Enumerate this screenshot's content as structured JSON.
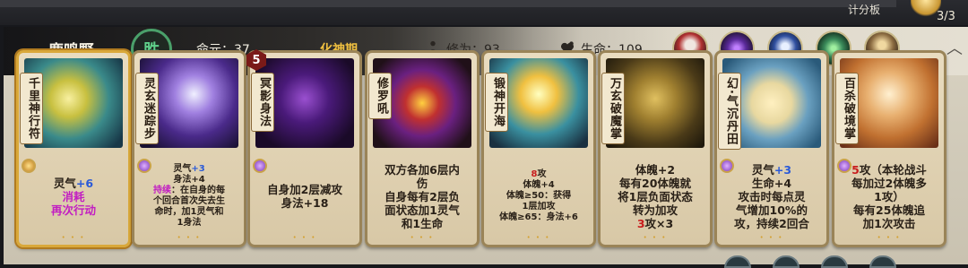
{
  "topbar": {
    "score_label": "计分板",
    "round": "3/3"
  },
  "player": {
    "name": "鹿鸣野",
    "result": "胜",
    "life_label": "命元：",
    "life": "37",
    "realm": "化神期",
    "cultivation_label": "修为：",
    "cultivation": "93",
    "hp_label": "生命：",
    "hp": "109"
  },
  "opponents": [
    "red-haired-cultivator",
    "purple-spirit",
    "blue-haired-cultivator",
    "green-spirit",
    "golden-warrior"
  ],
  "cards": [
    {
      "name": "千里神行符",
      "gem": "gold",
      "lines": [
        {
          "parts": [
            {
              "t": "灵气",
              "c": ""
            },
            {
              "t": "+6",
              "c": "blue"
            }
          ]
        },
        {
          "parts": [
            {
              "t": "消耗",
              "c": "magenta"
            }
          ]
        },
        {
          "parts": [
            {
              "t": "再次行动",
              "c": "magenta"
            }
          ]
        }
      ],
      "text_size": "big"
    },
    {
      "name": "灵玄迷踪步",
      "gem": "purple",
      "lines": [
        {
          "parts": [
            {
              "t": "灵气",
              "c": ""
            },
            {
              "t": "+3",
              "c": "blue"
            }
          ]
        },
        {
          "parts": [
            {
              "t": "身法+4",
              "c": ""
            }
          ]
        },
        {
          "parts": [
            {
              "t": "持续",
              "c": "magenta"
            },
            {
              "t": "：在自身的每",
              "c": ""
            }
          ]
        },
        {
          "parts": [
            {
              "t": "个回合首次失去生",
              "c": ""
            }
          ]
        },
        {
          "parts": [
            {
              "t": "命时，加1灵气和",
              "c": ""
            }
          ]
        },
        {
          "parts": [
            {
              "t": "1身法",
              "c": ""
            }
          ]
        }
      ],
      "text_size": "small"
    },
    {
      "name": "冥影身法",
      "gem": "purple",
      "cost": "5",
      "lines": [
        {
          "parts": [
            {
              "t": "自身加2层减攻",
              "c": ""
            }
          ]
        },
        {
          "parts": [
            {
              "t": "身法+18",
              "c": ""
            }
          ]
        }
      ],
      "text_size": "big"
    },
    {
      "name": "修罗吼",
      "gem": "",
      "lines": [
        {
          "parts": [
            {
              "t": "双方各加6层内",
              "c": ""
            }
          ]
        },
        {
          "parts": [
            {
              "t": "伤",
              "c": ""
            }
          ]
        },
        {
          "parts": [
            {
              "t": "自身每有2层负",
              "c": ""
            }
          ]
        },
        {
          "parts": [
            {
              "t": "面状态加1灵气",
              "c": ""
            }
          ]
        },
        {
          "parts": [
            {
              "t": "和1生命",
              "c": ""
            }
          ]
        }
      ],
      "text_size": "big"
    },
    {
      "name": "锻神开海",
      "gem": "",
      "lines": [
        {
          "parts": [
            {
              "t": "8",
              "c": "red"
            },
            {
              "t": "攻",
              "c": ""
            }
          ]
        },
        {
          "parts": [
            {
              "t": "体魄+4",
              "c": ""
            }
          ]
        },
        {
          "parts": [
            {
              "t": "体魄≥50：获得",
              "c": ""
            }
          ]
        },
        {
          "parts": [
            {
              "t": "1层加攻",
              "c": ""
            }
          ]
        },
        {
          "parts": [
            {
              "t": "体魄≥65：身法+6",
              "c": ""
            }
          ]
        }
      ],
      "text_size": "small"
    },
    {
      "name": "万玄破魔掌",
      "gem": "",
      "lines": [
        {
          "parts": [
            {
              "t": "体魄+2",
              "c": ""
            }
          ]
        },
        {
          "parts": [
            {
              "t": "每有20体魄就",
              "c": ""
            }
          ]
        },
        {
          "parts": [
            {
              "t": "将1层负面状态",
              "c": ""
            }
          ]
        },
        {
          "parts": [
            {
              "t": "转为加攻",
              "c": ""
            }
          ]
        },
        {
          "parts": [
            {
              "t": "3",
              "c": "red"
            },
            {
              "t": "攻×3",
              "c": ""
            }
          ]
        }
      ],
      "text_size": "big"
    },
    {
      "name": "幻·气沉丹田",
      "gem": "purple",
      "lines": [
        {
          "parts": [
            {
              "t": "灵气",
              "c": ""
            },
            {
              "t": "+3",
              "c": "blue"
            }
          ]
        },
        {
          "parts": [
            {
              "t": "生命+4",
              "c": ""
            }
          ]
        },
        {
          "parts": [
            {
              "t": "攻击时每点灵",
              "c": ""
            }
          ]
        },
        {
          "parts": [
            {
              "t": "气增加10%的",
              "c": ""
            }
          ]
        },
        {
          "parts": [
            {
              "t": "攻，持续2回合",
              "c": ""
            }
          ]
        }
      ],
      "text_size": "big"
    },
    {
      "name": "百杀破境掌",
      "gem": "purple",
      "lines": [
        {
          "parts": [
            {
              "t": "5",
              "c": "red"
            },
            {
              "t": "攻（本轮战斗",
              "c": ""
            }
          ]
        },
        {
          "parts": [
            {
              "t": "每加过2体魄多",
              "c": ""
            }
          ]
        },
        {
          "parts": [
            {
              "t": "1攻）",
              "c": ""
            }
          ]
        },
        {
          "parts": [
            {
              "t": "每有25体魄追",
              "c": ""
            }
          ]
        },
        {
          "parts": [
            {
              "t": "加1次攻击",
              "c": ""
            }
          ]
        }
      ],
      "text_size": "big"
    }
  ]
}
